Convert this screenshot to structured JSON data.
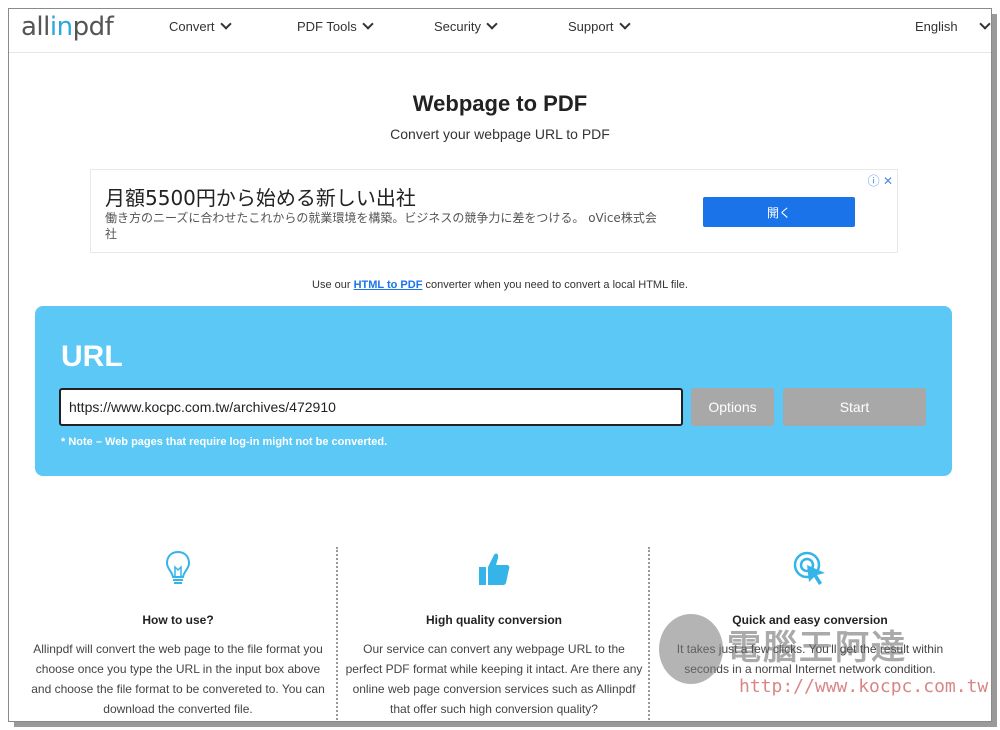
{
  "logo": {
    "text_pre": "all",
    "text_dot": "in",
    "text_post": "pdf"
  },
  "nav": {
    "items": [
      {
        "label": "Convert"
      },
      {
        "label": "PDF Tools"
      },
      {
        "label": "Security"
      },
      {
        "label": "Support"
      }
    ],
    "language": "English"
  },
  "hero": {
    "title": "Webpage to PDF",
    "subtitle": "Convert your webpage URL to PDF"
  },
  "ad": {
    "headline": "月額5500円から始める新しい出社",
    "body": "働き方のニーズに合わせたこれからの就業環境を構築。ビジネスの競争力に差をつける。 oVice株式会社",
    "button": "開く",
    "icons": "ⓘ ✕"
  },
  "hint": {
    "pre": "Use our ",
    "link": "HTML to PDF",
    "post": " converter when you need to convert a local HTML file."
  },
  "panel": {
    "label": "URL",
    "url_value": "https://www.kocpc.com.tw/archives/472910",
    "options_label": "Options",
    "start_label": "Start",
    "note": "* Note – Web pages that require log-in might not be converted."
  },
  "features": [
    {
      "icon": "lightbulb-icon",
      "title": "How to use?",
      "desc": "Allinpdf will convert the web page to the file format you choose once you type the URL in the input box above and choose the file format to be convereted to. You can download the converted file."
    },
    {
      "icon": "thumbs-up-icon",
      "title": "High quality conversion",
      "desc": "Our service can convert any webpage URL to the perfect PDF format while keeping it intact. Are there any online web page conversion services such as Allinpdf that offer such high conversion quality?"
    },
    {
      "icon": "click-icon",
      "title": "Quick and easy conversion",
      "desc": "It takes just a few clicks. You'll get the result within seconds in a normal Internet network condition."
    }
  ],
  "watermark": {
    "text": "電腦王阿達",
    "url": "http://www.kocpc.com.tw"
  },
  "colors": {
    "panel": "#5bc8f5",
    "accent": "#2aa7e0",
    "button_gray": "#a8a8a8",
    "ad_button": "#1a73e8"
  }
}
